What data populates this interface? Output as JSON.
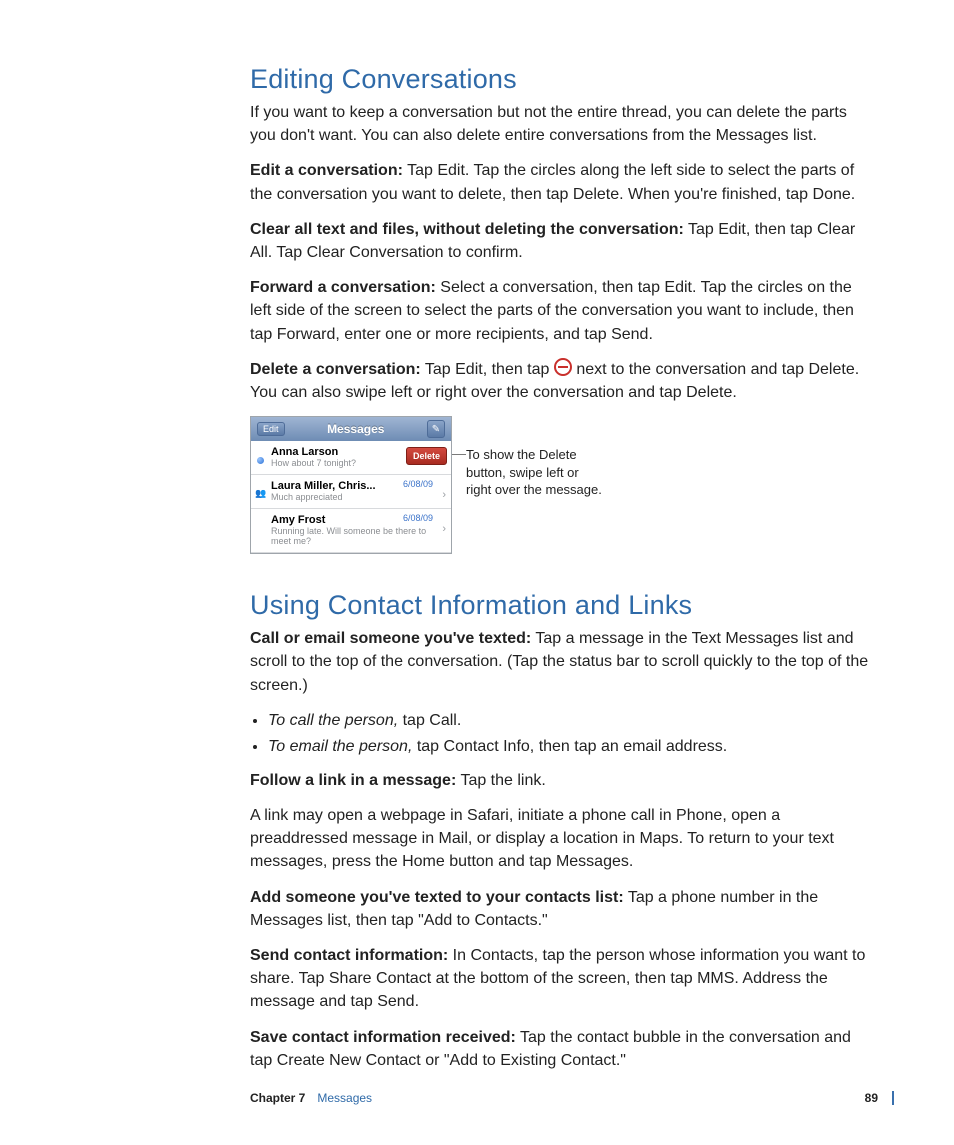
{
  "section1": {
    "heading": "Editing Conversations",
    "p1": "If you want to keep a conversation but not the entire thread, you can delete the parts you don't want. You can also delete entire conversations from the Messages list.",
    "p2_label": "Edit a conversation:",
    "p2_body": "  Tap Edit. Tap the circles along the left side to select the parts of the conversation you want to delete, then tap Delete. When you're finished, tap Done.",
    "p3_label": "Clear all text and files, without deleting the conversation:",
    "p3_body": "  Tap Edit, then tap Clear All. Tap Clear Conversation to confirm.",
    "p4_label": "Forward a conversation:",
    "p4_body": "  Select a conversation, then tap Edit. Tap the circles on the left side of the screen to select the parts of the conversation you want to include, then tap Forward, enter one or more recipients, and tap Send.",
    "p5_label": "Delete a conversation:",
    "p5_body_a": "  Tap Edit, then tap ",
    "p5_body_b": " next to the conversation and tap Delete. You can also swipe left or right over the conversation and tap Delete."
  },
  "figure": {
    "edit": "Edit",
    "title": "Messages",
    "rows": [
      {
        "name": "Anna Larson",
        "preview": "How about 7 tonight?",
        "delete": "Delete"
      },
      {
        "name": "Laura Miller, Chris...",
        "preview": "Much appreciated",
        "date": "6/08/09"
      },
      {
        "name": "Amy Frost",
        "preview": "Running late. Will someone be there to meet me?",
        "date": "6/08/09"
      }
    ],
    "callout": "To show the Delete button, swipe left or right over the message."
  },
  "section2": {
    "heading": "Using Contact Information and Links",
    "p1_label": "Call or email someone you've texted:",
    "p1_body": "  Tap a message in the Text Messages list and scroll to the top of the conversation. (Tap the status bar to scroll quickly to the top of the screen.)",
    "bullets": [
      {
        "ital": "To call the person,",
        "rest": " tap Call."
      },
      {
        "ital": "To email the person,",
        "rest": " tap Contact Info, then tap an email address."
      }
    ],
    "p2_label": "Follow a link in a message:",
    "p2_body": "  Tap the link.",
    "p3": "A link may open a webpage in Safari, initiate a phone call in Phone, open a preaddressed message in Mail, or display a location in Maps. To return to your text messages, press the Home button and tap Messages.",
    "p4_label": "Add someone you've texted to your contacts list:",
    "p4_body": "  Tap a phone number in the Messages list, then tap \"Add to Contacts.\"",
    "p5_label": "Send contact information:",
    "p5_body": "  In Contacts, tap the person whose information you want to share. Tap Share Contact at the bottom of the screen, then tap MMS. Address the message and tap Send.",
    "p6_label": "Save contact information received:",
    "p6_body": "  Tap the contact bubble in the conversation and tap Create New Contact or \"Add to Existing Contact.\""
  },
  "footer": {
    "chapter": "Chapter 7",
    "title": "Messages",
    "page": "89"
  }
}
